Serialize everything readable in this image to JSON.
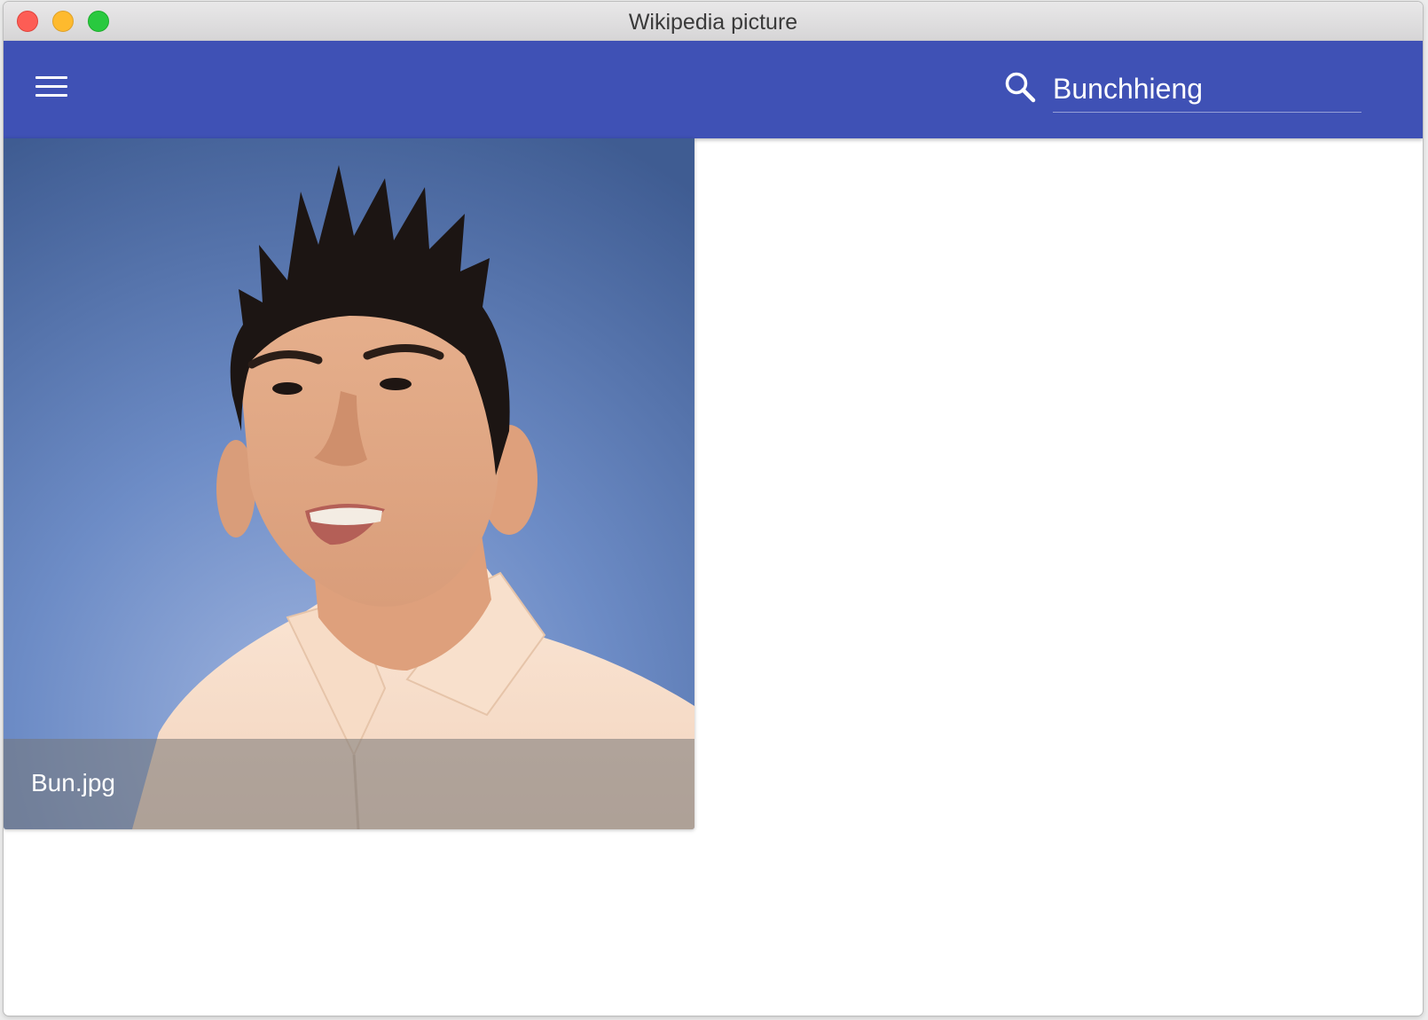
{
  "window": {
    "title": "Wikipedia picture"
  },
  "toolbar": {
    "menu_icon": "hamburger-menu-icon",
    "search_icon": "magnifier-icon",
    "search_value": "Bunchhieng",
    "accent_color": "#3f51b5"
  },
  "results": [
    {
      "caption": "Bun.jpg",
      "image_subject": "portrait photo"
    }
  ]
}
